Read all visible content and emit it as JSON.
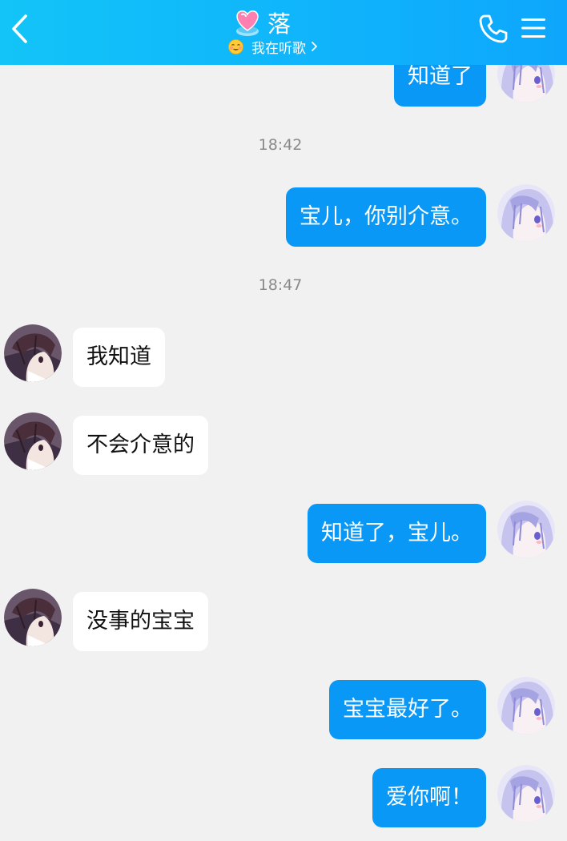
{
  "header": {
    "title": "落",
    "status_text": "我在听歌"
  },
  "colors": {
    "header_start": "#12c4f8",
    "header_end": "#0ea6fc",
    "outgoing_bubble": "#0a98f6",
    "incoming_bubble": "#ffffff",
    "chat_background": "#f1f1f1"
  },
  "icons": {
    "back": "chevron-left-icon",
    "title_badge": "heart-icon",
    "status": "smile-emoji-icon",
    "call": "phone-icon",
    "menu": "menu-icon"
  },
  "chat": {
    "timestamps": [
      "18:42",
      "18:47"
    ],
    "messages": [
      {
        "from": "me",
        "text": "知道了"
      },
      {
        "from": "me",
        "text": "宝儿，你别介意。"
      },
      {
        "from": "other",
        "text": "我知道"
      },
      {
        "from": "other",
        "text": "不会介意的"
      },
      {
        "from": "me",
        "text": "知道了，宝儿。"
      },
      {
        "from": "other",
        "text": "没事的宝宝"
      },
      {
        "from": "me",
        "text": "宝宝最好了。"
      },
      {
        "from": "me",
        "text": "爱你啊！"
      }
    ]
  }
}
